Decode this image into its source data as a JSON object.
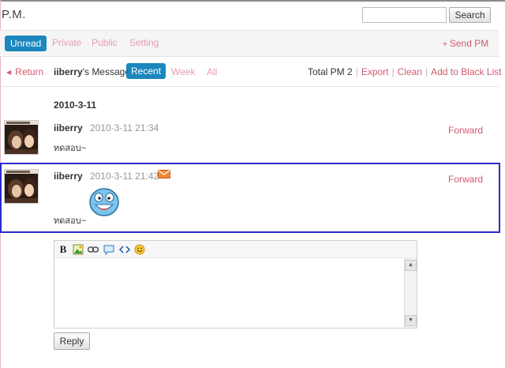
{
  "header": {
    "title": "P.M.",
    "search_placeholder": "",
    "search_label": "Search"
  },
  "tabs": {
    "items": [
      "Unread",
      "Private",
      "Public",
      "Setting"
    ],
    "active": "Unread",
    "send_pm": "Send PM"
  },
  "subnav": {
    "return_label": "Return",
    "user": "iiberry",
    "message_suffix": "'s Message:",
    "filters": [
      "Recent",
      "Week",
      "All"
    ],
    "active_filter": "Recent",
    "total_text": "Total PM 2",
    "actions": [
      "Export",
      "Clean",
      "Add to Black List"
    ]
  },
  "conversation": {
    "date": "2010-3-11",
    "messages": [
      {
        "user": "iiberry",
        "time": "2010-3-11 21:34",
        "text": "ทดสอบ~",
        "forward": "Forward"
      },
      {
        "user": "iiberry",
        "time": "2010-3-11 21:42",
        "text": "ทดสอบ~",
        "forward": "Forward",
        "has_mail_icon": true,
        "has_smiley": true
      }
    ]
  },
  "editor": {
    "toolbar_icons": [
      "bold-icon",
      "image-icon",
      "link-icon",
      "quote-icon",
      "code-icon",
      "smiley-icon"
    ],
    "value": "",
    "reply_label": "Reply"
  },
  "colors": {
    "accent_blue": "#1b87be",
    "link_pink": "#d05a70",
    "tab_pink": "#e69cb3",
    "highlight_border": "#2a2acc"
  }
}
